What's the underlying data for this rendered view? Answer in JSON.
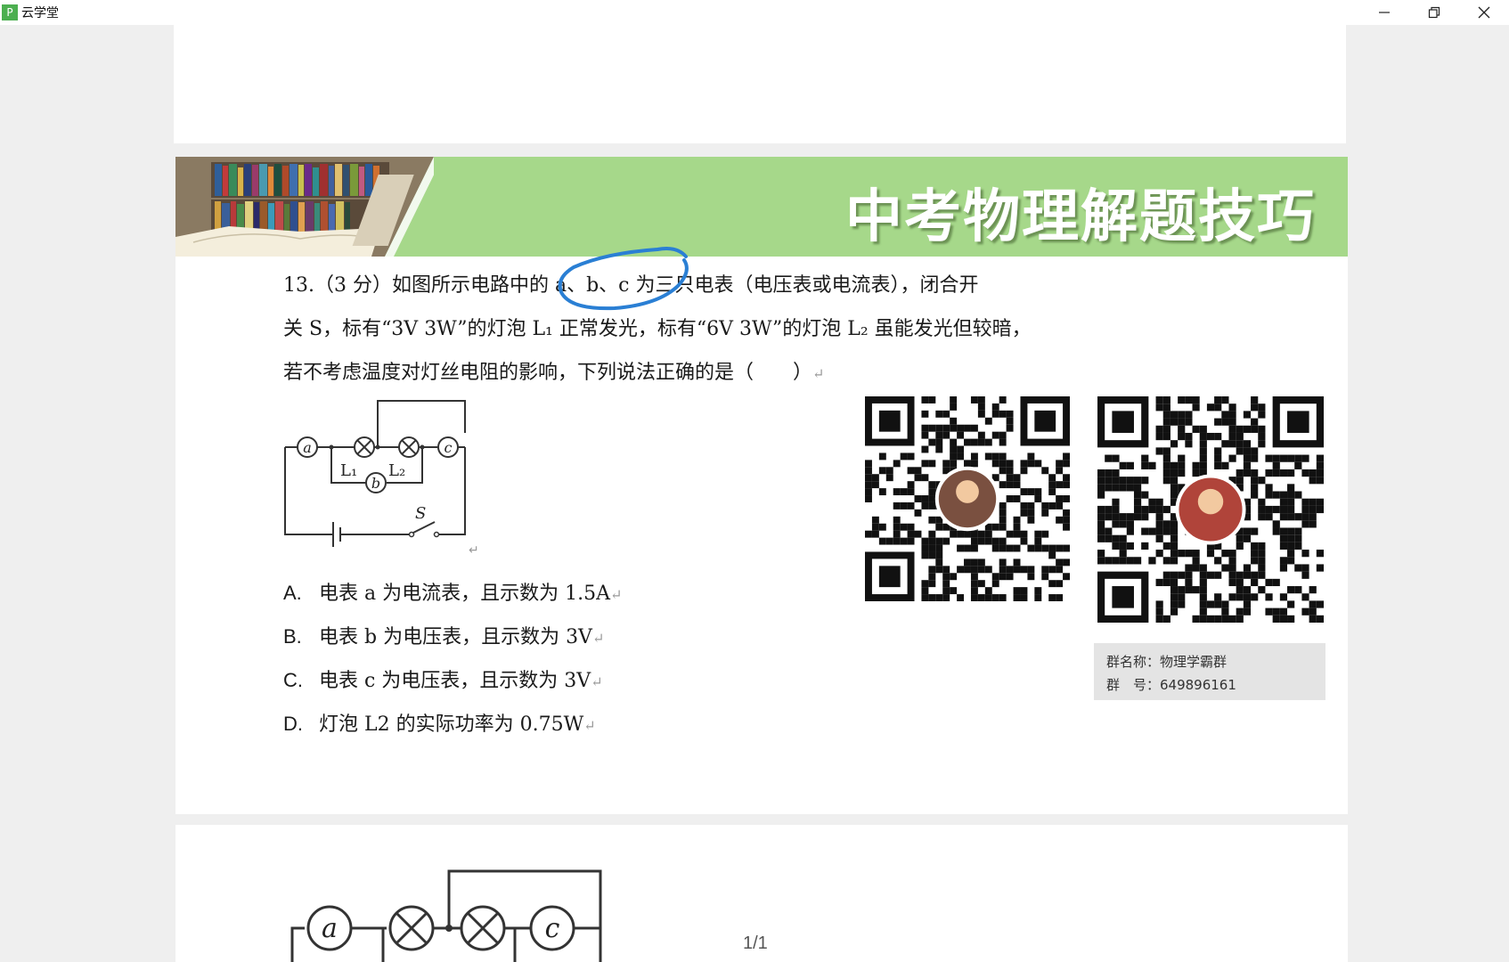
{
  "window": {
    "app_icon_glyph": "P",
    "title": "云学堂",
    "controls": [
      "minimize-icon",
      "restore-icon",
      "close-icon"
    ]
  },
  "banner": {
    "title": "中考物理解题技巧"
  },
  "question": {
    "line1": "13.（3 分）如图所示电路中的 a、b、c 为三只电表（电压表或电流表），闭合开",
    "line2": "关 S，标有“3V 3W”的灯泡 L₁ 正常发光，标有“6V 3W”的灯泡 L₂ 虽能发光但较暗，",
    "line3": "若不考虑温度对灯丝电阻的影响，下列说法正确的是（　　）",
    "return_mark": "↵"
  },
  "circuit": {
    "meter_a": "a",
    "meter_b": "b",
    "meter_c": "c",
    "lamp1": "L₁",
    "lamp2": "L₂",
    "switch": "S"
  },
  "options": [
    {
      "label": "A.",
      "text": "电表 a 为电流表，且示数为 1.5A"
    },
    {
      "label": "B.",
      "text": "电表 b 为电压表，且示数为 3V"
    },
    {
      "label": "C.",
      "text": "电表 c 为电压表，且示数为 3V"
    },
    {
      "label": "D.",
      "text": "灯泡 L2 的实际功率为 0.75W"
    }
  ],
  "group": {
    "name_line": "群名称：物理学霸群",
    "number_line": "群　号：649896161"
  },
  "page_indicator": "1/1",
  "colors": {
    "banner": "#a6d88a",
    "annotation": "#2a7fd4",
    "page_bg": "#ffffff",
    "viewer_bg": "#efefef"
  }
}
